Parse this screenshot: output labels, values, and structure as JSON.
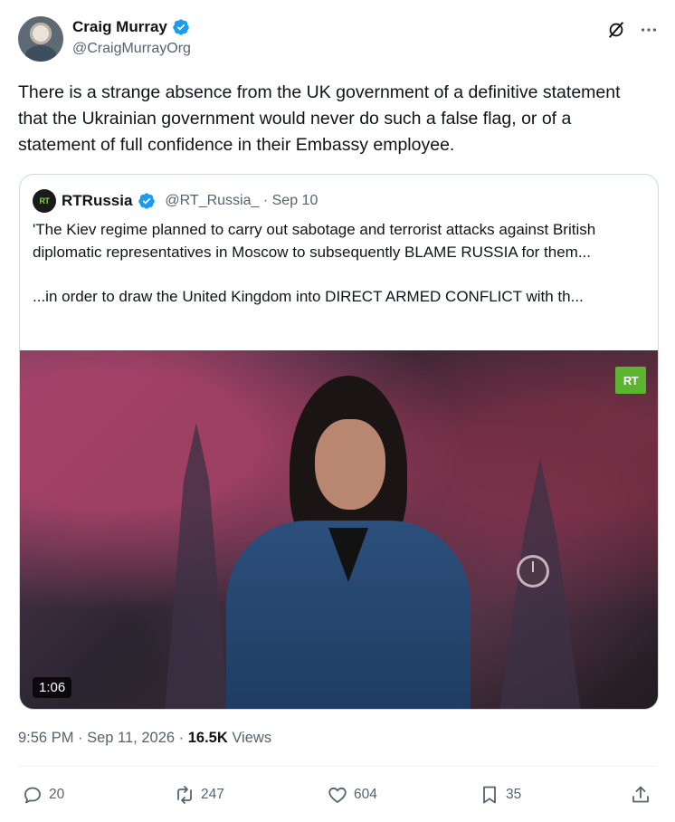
{
  "author": {
    "name": "Craig Murray",
    "handle": "@CraigMurrayOrg"
  },
  "tweet": {
    "text": "There is a strange absence from the UK government of a definitive statement that the Ukrainian government would never do such a false flag, or of a statement of full confidence in their Embassy employee."
  },
  "quote": {
    "logo_text": "RT",
    "name": "RTRussia",
    "handle_date": "@RT_Russia_ · Sep 10",
    "paragraph1": "'The Kiev regime planned to carry out sabotage and terrorist attacks against British diplomatic representatives in Moscow to subsequently BLAME RUSSIA for them...",
    "paragraph2": "...in order to draw the United Kingdom into DIRECT ARMED CONFLICT with th...",
    "video": {
      "badge": "RT",
      "duration": "1:06"
    }
  },
  "meta": {
    "time_date": "9:56 PM · Sep 11, 2026 · ",
    "views_count": "16.5K",
    "views_label": " Views"
  },
  "actions": {
    "replies": "20",
    "reposts": "247",
    "likes": "604",
    "bookmarks": "35"
  },
  "colors": {
    "verified": "#1d9bf0",
    "secondary_text": "#536471",
    "rt_green": "#5cb531"
  },
  "icons": [
    "verified-icon",
    "grok-icon",
    "more-icon",
    "reply-icon",
    "repost-icon",
    "like-icon",
    "bookmark-icon",
    "share-icon"
  ]
}
